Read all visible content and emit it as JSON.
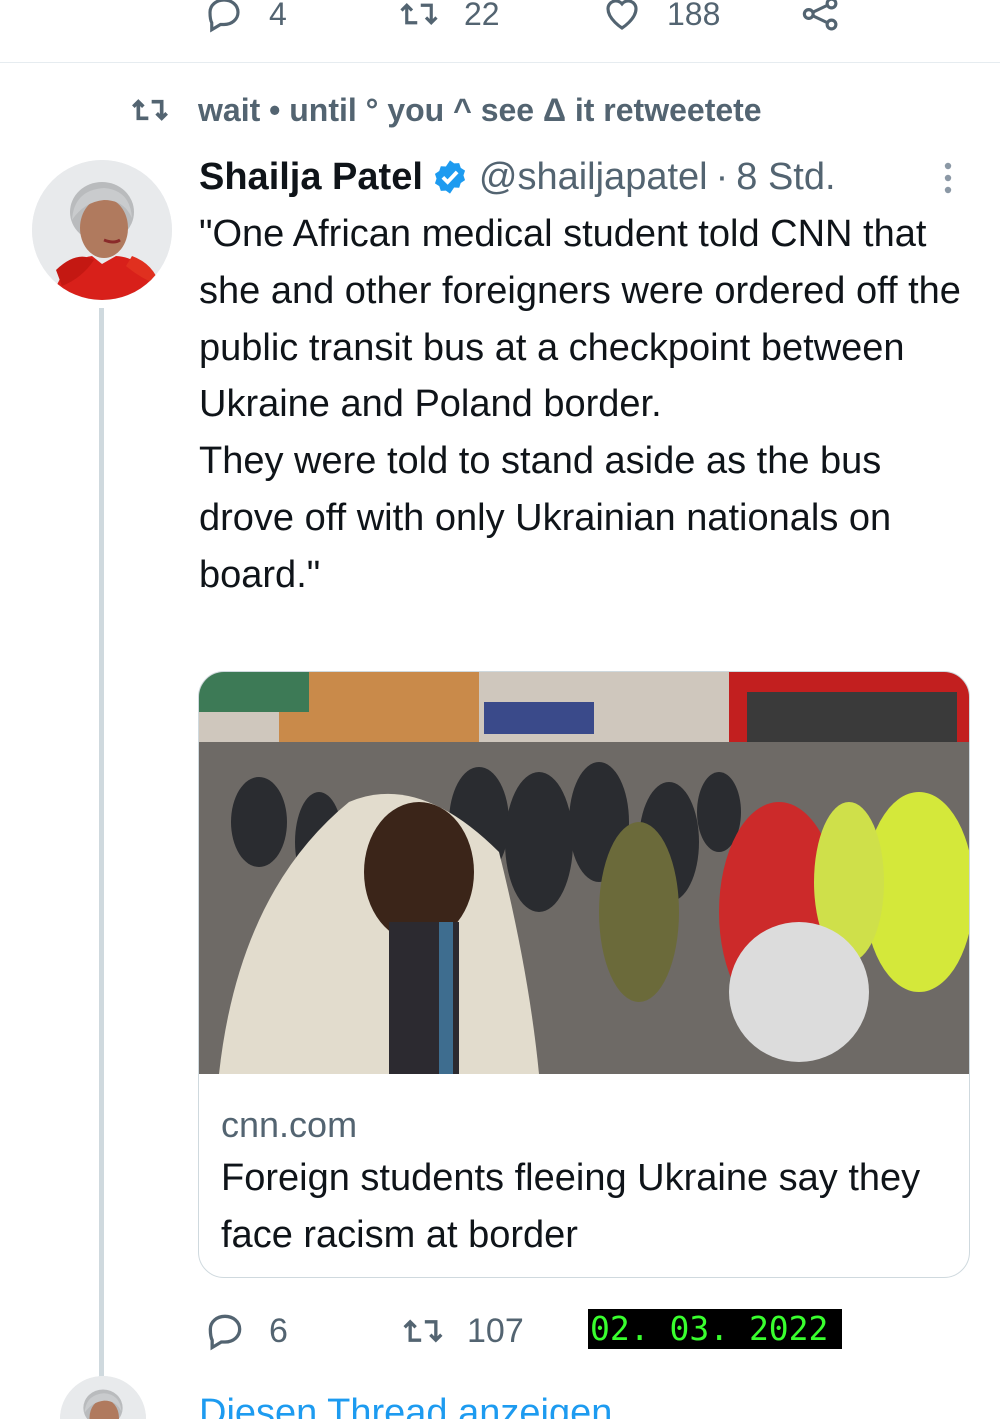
{
  "top_actions": {
    "replies": "4",
    "retweets": "22",
    "likes": "188",
    "icons": [
      "reply-icon",
      "retweet-icon",
      "like-icon",
      "share-icon"
    ]
  },
  "retweet_context": {
    "icon": "retweet-icon",
    "text": "wait • until ° you ^ see Δ it retweetete"
  },
  "tweet": {
    "author_name": "Shailja Patel",
    "verified": true,
    "handle": "@shailjapatel",
    "separator": "·",
    "time": "8 Std.",
    "body_paragraphs": [
      "\"One African medical student told CNN that she and other foreigners were ordered off the public transit bus at a checkpoint between Ukraine and Poland border.",
      "They were told to stand aside as the bus drove off with only Ukrainian nationals on board.\""
    ],
    "card": {
      "domain": "cnn.com",
      "title": "Foreign students fleeing Ukraine say they face racism at border"
    }
  },
  "bottom_actions": {
    "replies": "6",
    "retweets": "107"
  },
  "date_stamp": "02. 03. 2022",
  "show_thread": "Diesen Thread anzeigen",
  "colors": {
    "text_primary": "#0f1419",
    "text_secondary": "#536471",
    "accent_blue": "#1d9bf0",
    "thread_line": "#cfd9de",
    "stamp_bg": "#000000",
    "stamp_fg": "#39ff2e"
  }
}
